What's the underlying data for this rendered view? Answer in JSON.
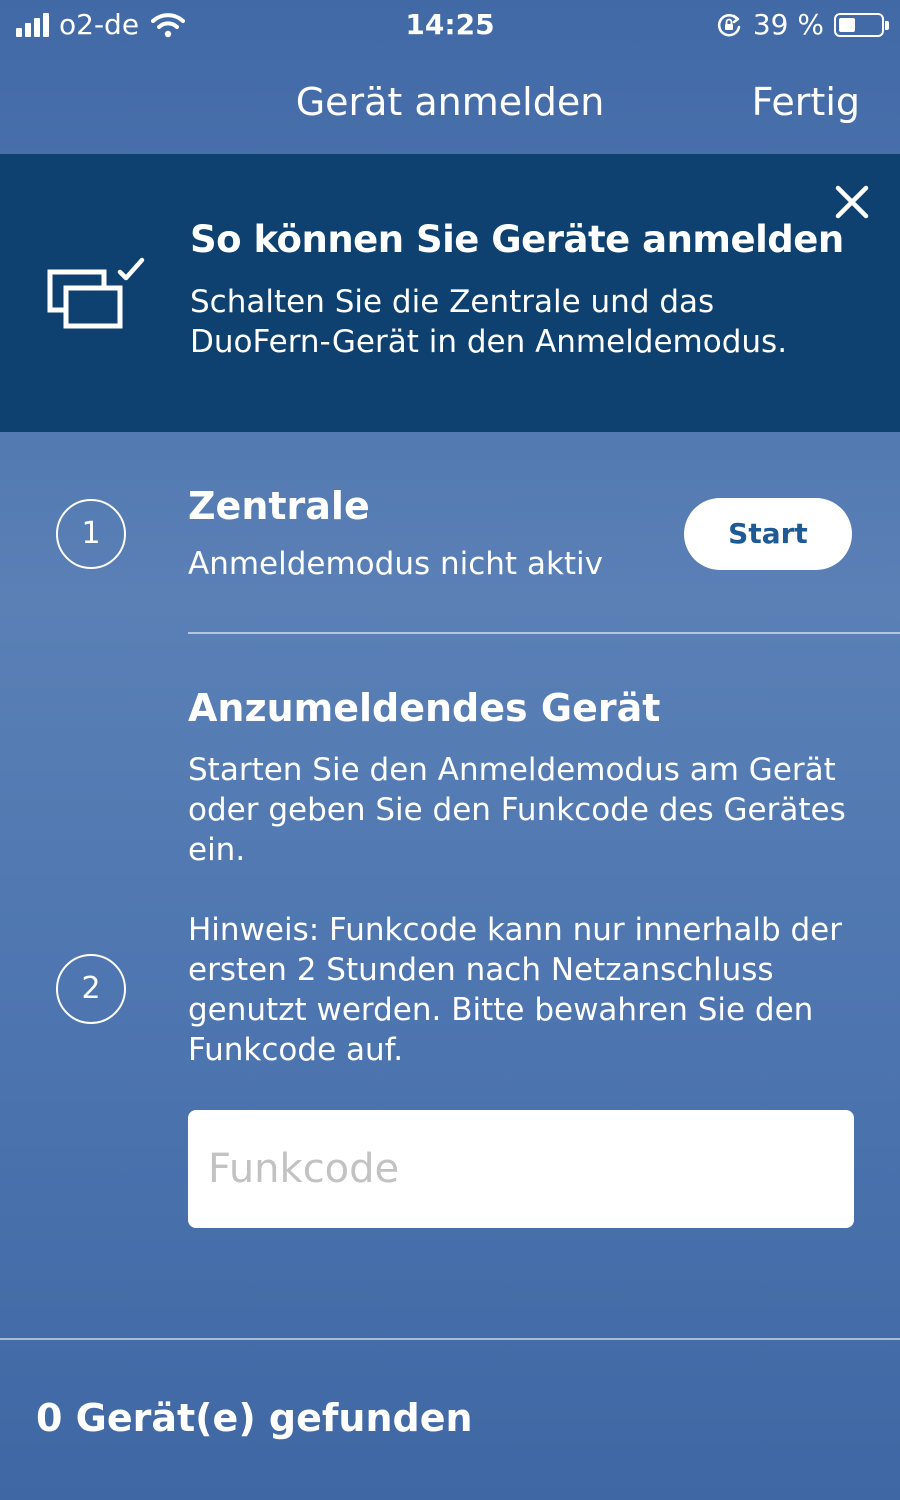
{
  "status_bar": {
    "carrier": "o2-de",
    "time": "14:25",
    "battery_text": "39 %",
    "battery_level": 0.39,
    "icons": [
      "signal-icon",
      "wifi-icon",
      "rotation-lock-icon",
      "battery-icon"
    ]
  },
  "nav": {
    "title": "Gerät anmelden",
    "done_label": "Fertig"
  },
  "banner": {
    "title": "So können Sie Geräte anmelden",
    "text": "Schalten Sie die Zentrale und das DuoFern-Gerät in den Anmeldemodus.",
    "icon": "devices-check-icon",
    "close_icon": "close-icon",
    "background": "#0f4170"
  },
  "step1": {
    "number": "1",
    "title": "Zentrale",
    "status": "Anmeldemodus nicht aktiv",
    "button_label": "Start"
  },
  "step2": {
    "number": "2",
    "title": "Anzumeldendes Gerät",
    "text": "Starten Sie den Anmeldemodus am Gerät oder geben Sie den Funkcode des Gerätes ein.",
    "hint": "Hinweis: Funkcode kann nur innerhalb der ersten 2 Stunden nach Netzanschluss genutzt werden. Bitte bewahren Sie den Funkcode auf.",
    "input_placeholder": "Funkcode",
    "input_value": ""
  },
  "footer": {
    "found_text": "0 Gerät(e) gefunden"
  },
  "colors": {
    "accent": "#1e5a96",
    "background": "#4a72ad",
    "banner": "#0f4170"
  }
}
